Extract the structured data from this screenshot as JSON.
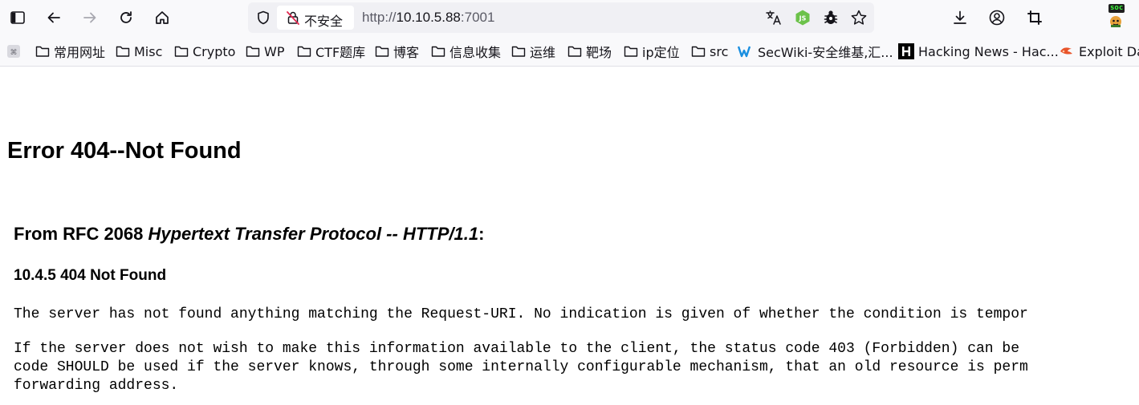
{
  "urlbar": {
    "security_label": "不安全",
    "url_scheme": "http://",
    "url_host": "10.10.5.88",
    "url_port": ":7001"
  },
  "extension_badge": "soc",
  "bookmarks": [
    {
      "label": "常用网址",
      "icon": "folder-icon"
    },
    {
      "label": "Misc",
      "icon": "folder-icon"
    },
    {
      "label": "Crypto",
      "icon": "folder-icon"
    },
    {
      "label": "WP",
      "icon": "folder-icon"
    },
    {
      "label": "CTF题库",
      "icon": "folder-icon"
    },
    {
      "label": "博客",
      "icon": "folder-icon"
    },
    {
      "label": "信息收集",
      "icon": "folder-icon"
    },
    {
      "label": "运维",
      "icon": "folder-icon"
    },
    {
      "label": "靶场",
      "icon": "folder-icon"
    },
    {
      "label": "ip定位",
      "icon": "folder-icon"
    },
    {
      "label": "src",
      "icon": "folder-icon"
    },
    {
      "label": "SecWiki-安全维基,汇...",
      "icon": "secwiki-icon"
    },
    {
      "label": "Hacking News - Hac...",
      "icon": "hacking-news-icon"
    },
    {
      "label": "Exploit Dat",
      "icon": "exploit-db-icon"
    }
  ],
  "page": {
    "title": "Error 404--Not Found",
    "rfc_prefix": "From RFC 2068 ",
    "rfc_title": "Hypertext Transfer Protocol -- HTTP/1.1",
    "rfc_suffix": ":",
    "section_heading": "10.4.5 404 Not Found",
    "paragraph1": "The server has not found anything matching the Request-URI. No indication is given of whether the condition is tempor",
    "paragraph2_line1": "If the server does not wish to make this information available to the client, the status code 403 (Forbidden) can be",
    "paragraph2_line2": "code SHOULD be used if the server knows, through some internally configurable mechanism, that an old resource is perm",
    "paragraph2_line3": "forwarding address."
  }
}
